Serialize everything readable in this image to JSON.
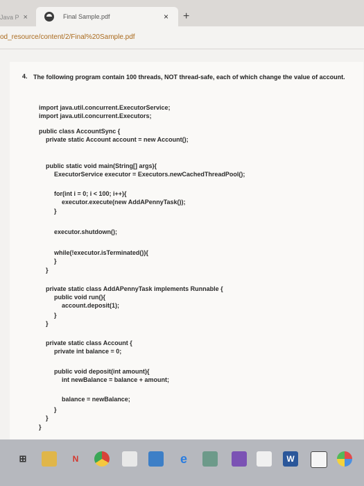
{
  "browser": {
    "prev_tab_label": "Java P",
    "prev_tab_close": "×",
    "active_tab_title": "Final Sample.pdf",
    "active_tab_close": "×",
    "new_tab": "+",
    "url_prefix": "od_resource/content/2/",
    "url_highlight": "Final%20Sample.pdf"
  },
  "document": {
    "question_number": "4.",
    "question_text": "The following program contain 100 threads, NOT thread-safe, each of which change the value of account.",
    "code_lines": [
      "import java.util.concurrent.ExecutorService;",
      "import java.util.concurrent.Executors;",
      "public class AccountSync {",
      "private static Account account = new Account();",
      "public static void main(String[] args){",
      "ExecutorService executor = Executors.newCachedThreadPool();",
      "for(int i = 0; i < 100; i++){",
      "executor.execute(new AddAPennyTask());",
      "}",
      "executor.shutdown();",
      "while(!executor.isTerminated()){",
      "}",
      "}",
      "private static class AddAPennyTask implements Runnable {",
      "public void run(){",
      "account.deposit(1);",
      "}",
      "}",
      "private static class Account {",
      "private int balance = 0;",
      "public void deposit(int amount){",
      "int newBalance = balance + amount;",
      "balance = newBalance;",
      "}",
      "}",
      "}"
    ]
  },
  "taskbar": {
    "icons": [
      "task-view-icon",
      "file-explorer-icon",
      "app-n-icon",
      "chrome-icon",
      "store-icon",
      "photos-icon",
      "edge-icon",
      "app-icon",
      "visual-studio-icon",
      "netbeans-icon",
      "word-icon",
      "notepad-icon",
      "paint-icon"
    ],
    "n_label": "N",
    "word_label": "W"
  }
}
